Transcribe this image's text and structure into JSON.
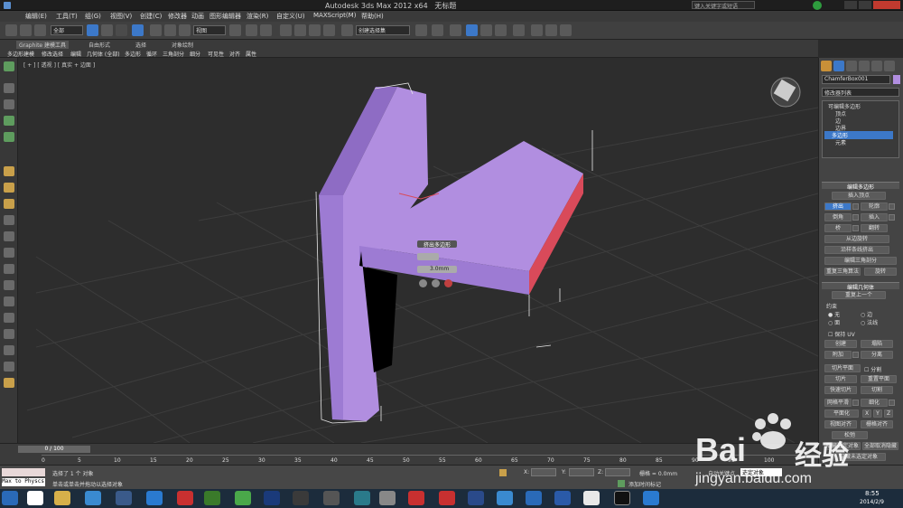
{
  "window": {
    "title": "Autodesk 3ds Max  2012 x64",
    "doc": "无标题",
    "search_placeholder": "键入关键字或短语"
  },
  "menus": [
    "编辑(E)",
    "工具(T)",
    "组(G)",
    "视图(V)",
    "创建(C)",
    "修改器",
    "动画",
    "图形编辑器",
    "渲染(R)",
    "自定义(U)",
    "MAXScript(M)",
    "帮助(H)"
  ],
  "toolbar": {
    "selection_filter": "全部",
    "ref_coord": "视图",
    "named_sel": "创建选择集"
  },
  "ribbon": {
    "tabs": [
      "Graphite 建模工具",
      "自由形式",
      "选择",
      "对象绘制"
    ],
    "subtabs": [
      "多边形建模",
      "修改选择",
      "编辑",
      "几何体 (全部)",
      "多边形",
      "循环",
      "三角剖分",
      "细分",
      "可见性",
      "对齐",
      "属性"
    ]
  },
  "viewport": {
    "label": "[ + ] [ 透视 ] [ 真实 + 边面 ]",
    "caddy": {
      "title": "挤出多边形",
      "height": "3.0mm"
    }
  },
  "command_panel": {
    "object_name": "ChamferBox001",
    "modifier_list": "修改器列表",
    "stack": [
      {
        "label": "可编辑多边形",
        "sel": false
      },
      {
        "label": "顶点",
        "sel": false
      },
      {
        "label": "边",
        "sel": false
      },
      {
        "label": "边界",
        "sel": false
      },
      {
        "label": "多边形",
        "sel": true
      },
      {
        "label": "元素",
        "sel": false
      }
    ],
    "edit_poly": {
      "title": "编辑多边形",
      "insert_vertex": "插入顶点",
      "extrude": "挤出",
      "outline": "轮廓",
      "bevel": "倒角",
      "inset": "插入",
      "bridge": "桥",
      "flip": "翻转",
      "hinge": "从边旋转",
      "extrude_spline": "沿样条线挤出",
      "edit_tri": "编辑三角剖分",
      "retri": "重复三角算法",
      "turn": "旋转"
    },
    "edit_geom": {
      "title": "编辑几何体",
      "repeat": "重复上一个",
      "constraints": "约束",
      "none": "无",
      "edge": "边",
      "face": "面",
      "normal": "法线",
      "preserve_uv": "保持 UV",
      "create": "创建",
      "collapse": "塌陷",
      "attach": "附加",
      "detach": "分离",
      "slice_plane": "切片平面",
      "split": "分割",
      "slice": "切片",
      "reset_plane": "重置平面",
      "quickslice": "快速切片",
      "cut": "切割",
      "msmooth": "网格平滑",
      "tessellate": "细化",
      "make_planar": "平面化",
      "x": "X",
      "y": "Y",
      "z": "Z",
      "view_align": "视图对齐",
      "grid_align": "栅格对齐",
      "relax": "松弛",
      "hide_sel": "隐藏选定对象",
      "unhide_all": "全部取消隐藏",
      "hide_unsel": "隐藏未选定对象"
    }
  },
  "timeline": {
    "frame": "0 / 100",
    "ticks": [
      "0",
      "5",
      "10",
      "15",
      "20",
      "25",
      "30",
      "35",
      "40",
      "45",
      "50",
      "55",
      "60",
      "65",
      "70",
      "75",
      "80",
      "85",
      "90",
      "95",
      "100"
    ]
  },
  "status": {
    "selected": "选择了 1 个 对象",
    "prompt": "单击或单击并拖动以选择对象",
    "x": "X:",
    "y": "Y:",
    "z": "Z:",
    "grid": "栅格 = 0.0mm",
    "add_key": "添加时间标记",
    "auto_key": "自动关键点",
    "key_sel": "选定对象",
    "script": "Max to Physcs"
  },
  "taskbar": {
    "time": "8:55",
    "date": "2014/2/9",
    "apps": [
      "ie",
      "explorer",
      "chrome",
      "flash",
      "dreamweaver",
      "360",
      "photoshop",
      "3dsmax",
      "maya",
      "app",
      "pdf",
      "acrobat",
      "ps2",
      "media",
      "word",
      "chrome2",
      "cmd",
      "ie2"
    ]
  },
  "watermark": {
    "brand": "Bai",
    "brand2": "经验",
    "url": "jingyan.baidu.com"
  },
  "colors": {
    "object": "#b18ee0",
    "object_dark": "#8e6cc4",
    "selected_face": "#d94a5a",
    "accent": "#3c78c8"
  }
}
